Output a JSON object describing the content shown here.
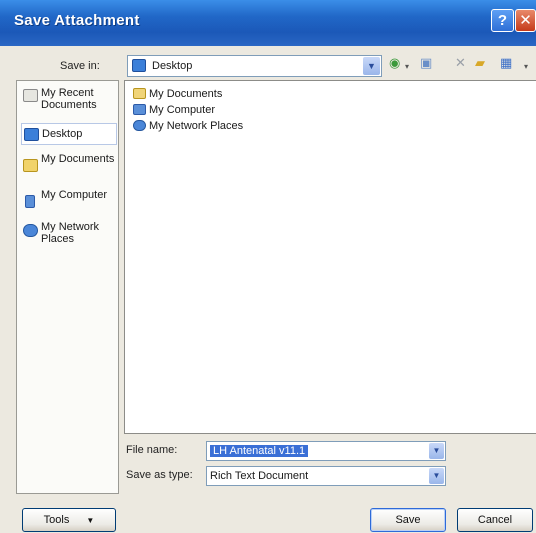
{
  "window": {
    "title": "Save Attachment",
    "help_label": "?",
    "close_label": "✕"
  },
  "save_in": {
    "label": "Save in:",
    "value": "Desktop"
  },
  "places": [
    {
      "label": "My Recent Documents",
      "icon": "recent-documents-icon"
    },
    {
      "label": "Desktop",
      "icon": "desktop-icon"
    },
    {
      "label": "My Documents",
      "icon": "my-documents-icon"
    },
    {
      "label": "My Computer",
      "icon": "my-computer-icon"
    },
    {
      "label": "My Network Places",
      "icon": "network-places-icon"
    }
  ],
  "files": [
    {
      "name": "My Documents",
      "icon": "folder-icon"
    },
    {
      "name": "My Computer",
      "icon": "computer-icon"
    },
    {
      "name": "My Network Places",
      "icon": "network-icon"
    }
  ],
  "file_name": {
    "label": "File name:",
    "value": "LH Antenatal v11.1"
  },
  "save_type": {
    "label": "Save as type:",
    "value": "Rich Text Document"
  },
  "buttons": {
    "tools": "Tools",
    "save": "Save",
    "cancel": "Cancel"
  },
  "colors": {
    "titlebar": "#2168c8",
    "selection": "#3a6fd6"
  }
}
